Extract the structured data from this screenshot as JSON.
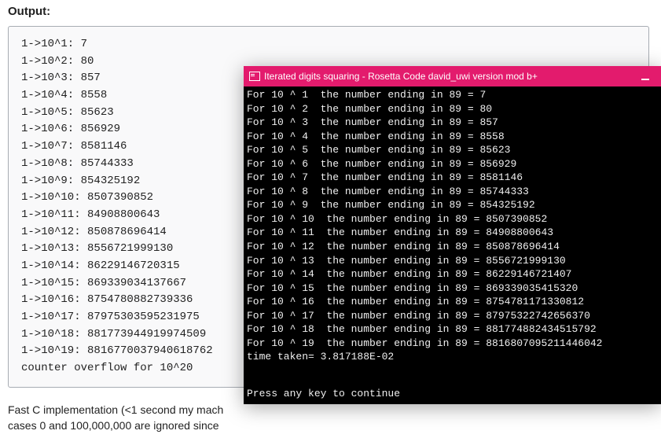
{
  "output_label": "Output:",
  "output_box": {
    "lines": [
      "1->10^1: 7",
      "1->10^2: 80",
      "1->10^3: 857",
      "1->10^4: 8558",
      "1->10^5: 85623",
      "1->10^6: 856929",
      "1->10^7: 8581146",
      "1->10^8: 85744333",
      "1->10^9: 854325192",
      "1->10^10: 8507390852",
      "1->10^11: 84908800643",
      "1->10^12: 850878696414",
      "1->10^13: 8556721999130",
      "1->10^14: 86229146720315",
      "1->10^15: 869339034137667",
      "1->10^16: 8754780882739336",
      "1->10^17: 87975303595231975",
      "1->10^18: 881773944919974509",
      "1->10^19: 8816770037940618762",
      "counter overflow for 10^20"
    ]
  },
  "bottom_text": {
    "line1": "Fast C implementation (<1 second my mach",
    "line2": "cases 0 and 100,000,000 are ignored since"
  },
  "terminal": {
    "title": "Iterated digits squaring - Rosetta Code david_uwi version mod b+",
    "lines": [
      "For 10 ^ 1  the number ending in 89 = 7",
      "For 10 ^ 2  the number ending in 89 = 80",
      "For 10 ^ 3  the number ending in 89 = 857",
      "For 10 ^ 4  the number ending in 89 = 8558",
      "For 10 ^ 5  the number ending in 89 = 85623",
      "For 10 ^ 6  the number ending in 89 = 856929",
      "For 10 ^ 7  the number ending in 89 = 8581146",
      "For 10 ^ 8  the number ending in 89 = 85744333",
      "For 10 ^ 9  the number ending in 89 = 854325192",
      "For 10 ^ 10  the number ending in 89 = 8507390852",
      "For 10 ^ 11  the number ending in 89 = 84908800643",
      "For 10 ^ 12  the number ending in 89 = 850878696414",
      "For 10 ^ 13  the number ending in 89 = 8556721999130",
      "For 10 ^ 14  the number ending in 89 = 86229146721407",
      "For 10 ^ 15  the number ending in 89 = 869339035415320",
      "For 10 ^ 16  the number ending in 89 = 8754781171330812",
      "For 10 ^ 17  the number ending in 89 = 87975322742656370",
      "For 10 ^ 18  the number ending in 89 = 881774882434515792",
      "For 10 ^ 19  the number ending in 89 = 8816807095211446042",
      "time taken= 3.817188E-02"
    ],
    "bottom_prompt": "Press any key to continue"
  }
}
